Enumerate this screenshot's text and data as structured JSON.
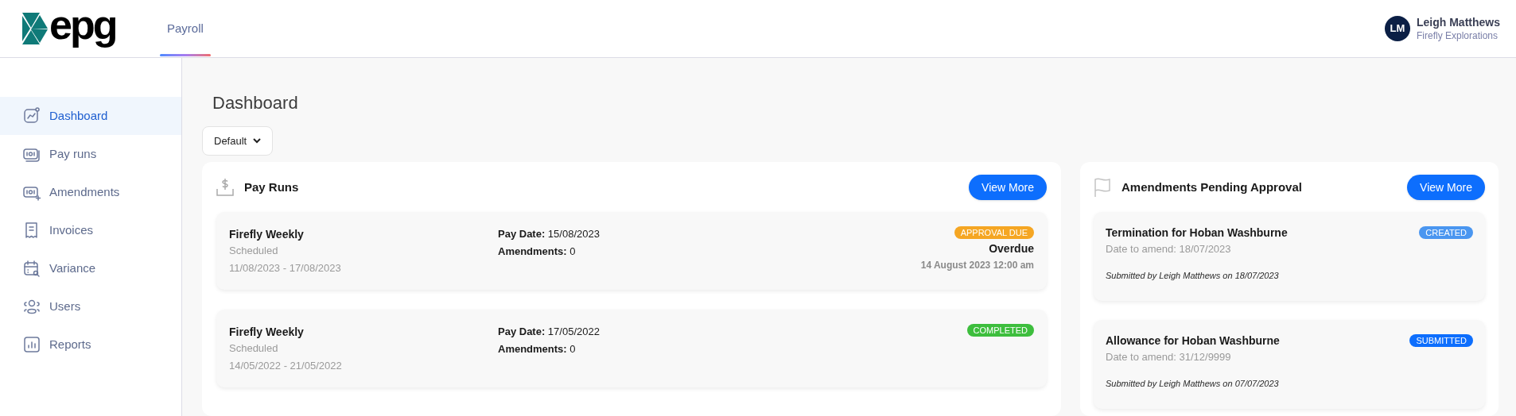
{
  "header": {
    "logo_text": "epg",
    "tabs": [
      {
        "label": "Payroll",
        "selected": true
      }
    ],
    "user": {
      "initials": "LM",
      "name": "Leigh Matthews",
      "company": "Firefly Explorations"
    }
  },
  "sidebar": {
    "items": [
      {
        "label": "Dashboard",
        "selected": true
      },
      {
        "label": "Pay runs",
        "selected": false
      },
      {
        "label": "Amendments",
        "selected": false
      },
      {
        "label": "Invoices",
        "selected": false
      },
      {
        "label": "Variance",
        "selected": false
      },
      {
        "label": "Users",
        "selected": false
      },
      {
        "label": "Reports",
        "selected": false
      }
    ]
  },
  "page_title": "Dashboard",
  "view_select": {
    "value": "Default"
  },
  "pay_runs": {
    "title": "Pay Runs",
    "button": "View More",
    "items": [
      {
        "name": "Firefly Weekly",
        "status": "Scheduled",
        "period": "11/08/2023 - 17/08/2023",
        "pay_date_label": "Pay Date:",
        "pay_date": "15/08/2023",
        "amendments_label": "Amendments:",
        "amendments": "0",
        "badge": "APPROVAL DUE",
        "color": "#f5a623",
        "due_label": "Overdue",
        "due_date": "14 August 2023 12:00 am"
      },
      {
        "name": "Firefly Weekly",
        "status": "Scheduled",
        "period": "14/05/2022 - 21/05/2022",
        "pay_date_label": "Pay Date:",
        "pay_date": "17/05/2022",
        "amendments_label": "Amendments:",
        "amendments": "0",
        "badge": "COMPLETED",
        "color": "#3dbe3d"
      }
    ]
  },
  "amendments": {
    "title": "Amendments Pending Approval",
    "button": "View More",
    "items": [
      {
        "title": "Termination for Hoban Washburne",
        "date": "Date to amend: 18/07/2023",
        "submitted": "Submitted by Leigh Matthews on 18/07/2023",
        "badge": "CREATED",
        "color": "#4a96f0"
      },
      {
        "title": "Allowance for Hoban Washburne",
        "date": "Date to amend: 31/12/9999",
        "submitted": "Submitted by Leigh Matthews on 07/07/2023",
        "badge": "SUBMITTED",
        "color": "#0d6efd"
      }
    ]
  }
}
